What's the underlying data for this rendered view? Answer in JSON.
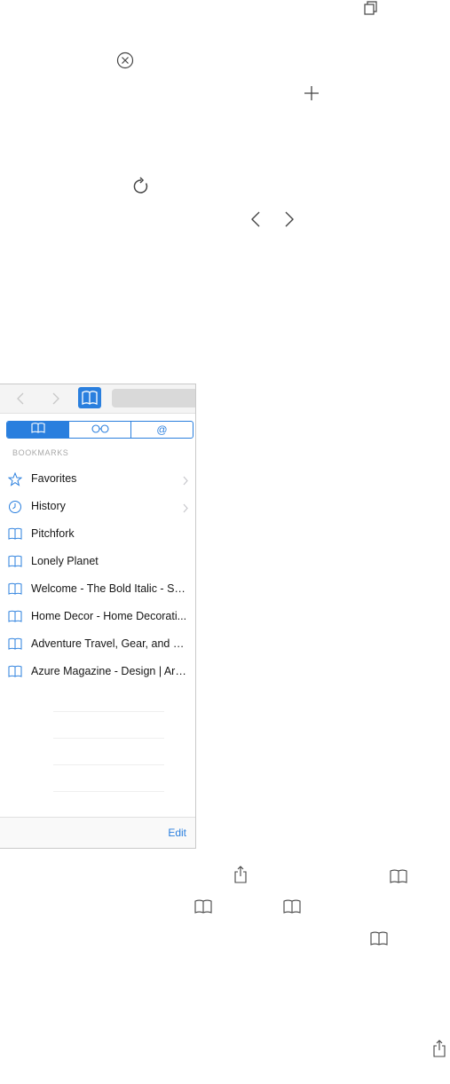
{
  "accent": "#2a7fde",
  "icons": {
    "tabs": "tabs-icon",
    "clear": "clear-circle-icon",
    "add": "plus-icon",
    "reload": "reload-icon",
    "back": "chevron-left-icon",
    "forward": "chevron-right-icon",
    "share": "share-icon",
    "bookmarks": "book-icon"
  },
  "panel": {
    "tabs": [
      {
        "name": "bookmarks-tab",
        "icon": "book-icon"
      },
      {
        "name": "reading-list-tab",
        "icon": "glasses-icon"
      },
      {
        "name": "shared-links-tab",
        "icon": "at-icon",
        "label": "@"
      }
    ],
    "section_title": "BOOKMARKS",
    "items": [
      {
        "label": "Favorites",
        "icon": "star-icon",
        "chevron": true
      },
      {
        "label": "History",
        "icon": "clock-icon",
        "chevron": true
      },
      {
        "label": "Pitchfork",
        "icon": "book-icon",
        "chevron": false
      },
      {
        "label": "Lonely Planet",
        "icon": "book-icon",
        "chevron": false
      },
      {
        "label": "Welcome - The Bold Italic - Sa...",
        "icon": "book-icon",
        "chevron": false
      },
      {
        "label": "Home Decor - Home Decorati...",
        "icon": "book-icon",
        "chevron": false
      },
      {
        "label": "Adventure Travel, Gear, and Fi...",
        "icon": "book-icon",
        "chevron": false
      },
      {
        "label": "Azure Magazine - Design | Arc...",
        "icon": "book-icon",
        "chevron": false
      }
    ],
    "edit_label": "Edit"
  }
}
